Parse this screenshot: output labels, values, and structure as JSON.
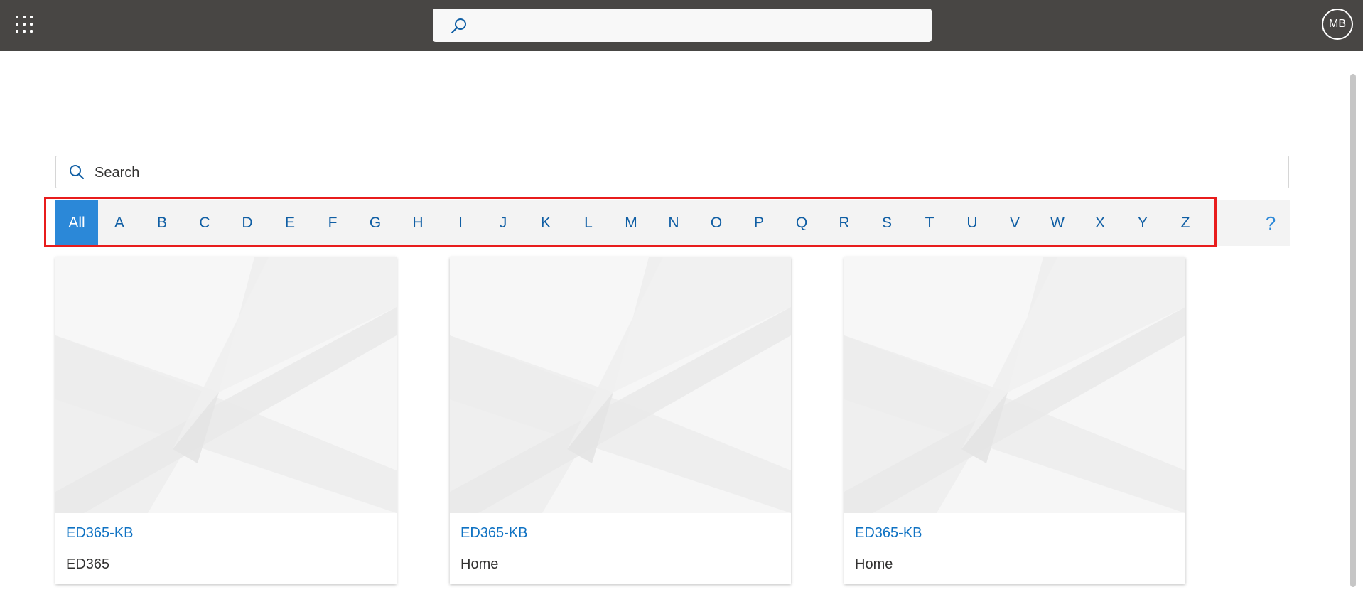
{
  "topbar": {
    "background": "#484644",
    "launcher_icon": "app-launcher-waffle-icon",
    "search_icon": "search-icon",
    "search_value": "",
    "avatar_initials": "MB"
  },
  "search": {
    "placeholder": "Search",
    "value": "",
    "icon": "search-icon"
  },
  "alphabet": {
    "selected": "All",
    "items": [
      "All",
      "A",
      "B",
      "C",
      "D",
      "E",
      "F",
      "G",
      "H",
      "I",
      "J",
      "K",
      "L",
      "M",
      "N",
      "O",
      "P",
      "Q",
      "R",
      "S",
      "T",
      "U",
      "V",
      "W",
      "X",
      "Y",
      "Z"
    ],
    "help_label": "?",
    "accent_color": "#2b88d8",
    "highlight_color": "#e81c1c"
  },
  "cards": [
    {
      "title": "ED365-KB",
      "subtitle": "ED365"
    },
    {
      "title": "ED365-KB",
      "subtitle": "Home"
    },
    {
      "title": "ED365-KB",
      "subtitle": "Home"
    }
  ]
}
